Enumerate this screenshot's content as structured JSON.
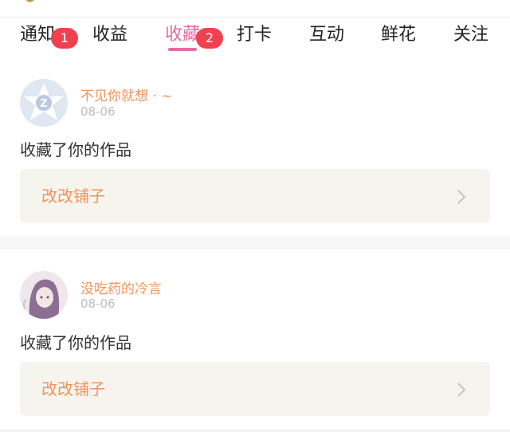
{
  "tabs": [
    {
      "label": "通知",
      "badge": "1"
    },
    {
      "label": "收益"
    },
    {
      "label": "收藏",
      "badge": "2",
      "active": true
    },
    {
      "label": "打卡"
    },
    {
      "label": "互动"
    },
    {
      "label": "鲜花"
    },
    {
      "label": "关注"
    }
  ],
  "colors": {
    "accent": "#e96aa0",
    "badge": "#f2404f",
    "username": "#f0935c",
    "work_box_bg": "#f5f5ee"
  },
  "items": [
    {
      "username": "不见你就想 · ~",
      "date": "08-06",
      "action": "收藏了你的作品",
      "work_title": "改改铺子",
      "avatar": "default-avatar-icon"
    },
    {
      "username": "没吃药的冷言",
      "date": "08-06",
      "action": "收藏了你的作品",
      "work_title": "改改铺子",
      "avatar": "user-photo"
    }
  ]
}
